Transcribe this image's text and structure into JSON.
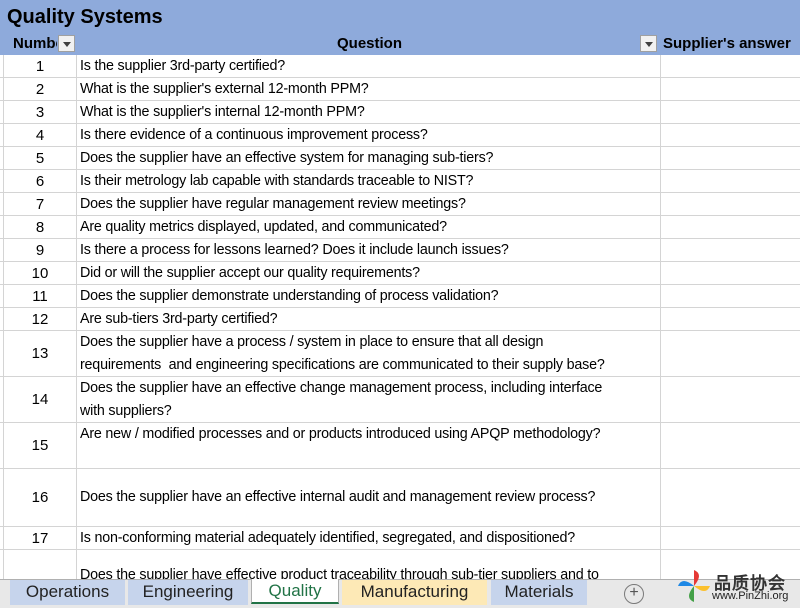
{
  "sheet_title": "Quality Systems",
  "columns": {
    "number": "Number",
    "question": "Question",
    "answer": "Supplier's answer"
  },
  "rows": [
    {
      "num": "1",
      "lines": [
        "Is the supplier 3rd-party certified?"
      ]
    },
    {
      "num": "2",
      "lines": [
        "What is the supplier's external 12-month PPM?"
      ]
    },
    {
      "num": "3",
      "lines": [
        "What is the supplier's internal 12-month PPM?"
      ]
    },
    {
      "num": "4",
      "lines": [
        "Is there evidence of a continuous improvement process?"
      ]
    },
    {
      "num": "5",
      "lines": [
        "Does the supplier have an effective system for managing sub-tiers?"
      ]
    },
    {
      "num": "6",
      "lines": [
        "Is their metrology lab capable with standards traceable to NIST?"
      ]
    },
    {
      "num": "7",
      "lines": [
        "Does the supplier have regular management review meetings?"
      ]
    },
    {
      "num": "8",
      "lines": [
        "Are quality metrics displayed, updated, and communicated?"
      ]
    },
    {
      "num": "9",
      "lines": [
        "Is there a process for lessons learned? Does it include launch issues?"
      ]
    },
    {
      "num": "10",
      "lines": [
        "Did or will the supplier accept our quality requirements?"
      ]
    },
    {
      "num": "11",
      "lines": [
        "Does the supplier demonstrate understanding of process validation?"
      ]
    },
    {
      "num": "12",
      "lines": [
        "Are sub-tiers 3rd-party certified?"
      ]
    },
    {
      "num": "13",
      "lines": [
        "Does the supplier have a process / system in place to ensure that all design",
        "requirements  and engineering specifications are communicated to their supply base?"
      ]
    },
    {
      "num": "14",
      "lines": [
        "Does the supplier have an effective change management process, including interface",
        "with suppliers?"
      ]
    },
    {
      "num": "15",
      "lines": [
        "Are new / modified processes and or products introduced using APQP methodology?"
      ]
    },
    {
      "num": "16",
      "lines": [
        "Does the supplier have an effective internal audit and management review process?"
      ]
    },
    {
      "num": "17",
      "lines": [
        "Is non-conforming material adequately identified, segregated, and dispositioned?"
      ]
    },
    {
      "num": "",
      "lines": [
        "Does the supplier have effective product traceability through sub-tier suppliers and to"
      ]
    }
  ],
  "tabs": [
    {
      "label": "Operations",
      "color": "#c6d4ec",
      "active": false
    },
    {
      "label": "Engineering",
      "color": "#c6d4ec",
      "active": false
    },
    {
      "label": "Quality",
      "color": "#ffffff",
      "active": true
    },
    {
      "label": "Manufacturing",
      "color": "#fde9b6",
      "active": false
    },
    {
      "label": "Materials",
      "color": "#c6d4ec",
      "active": false
    }
  ],
  "add_sheet_icon": "plus-circle-icon",
  "watermark": {
    "brand": "品质协会",
    "url": "www.PinZhi.org"
  },
  "colors": {
    "header": "#8eaadb",
    "active_tab_text": "#217346"
  }
}
